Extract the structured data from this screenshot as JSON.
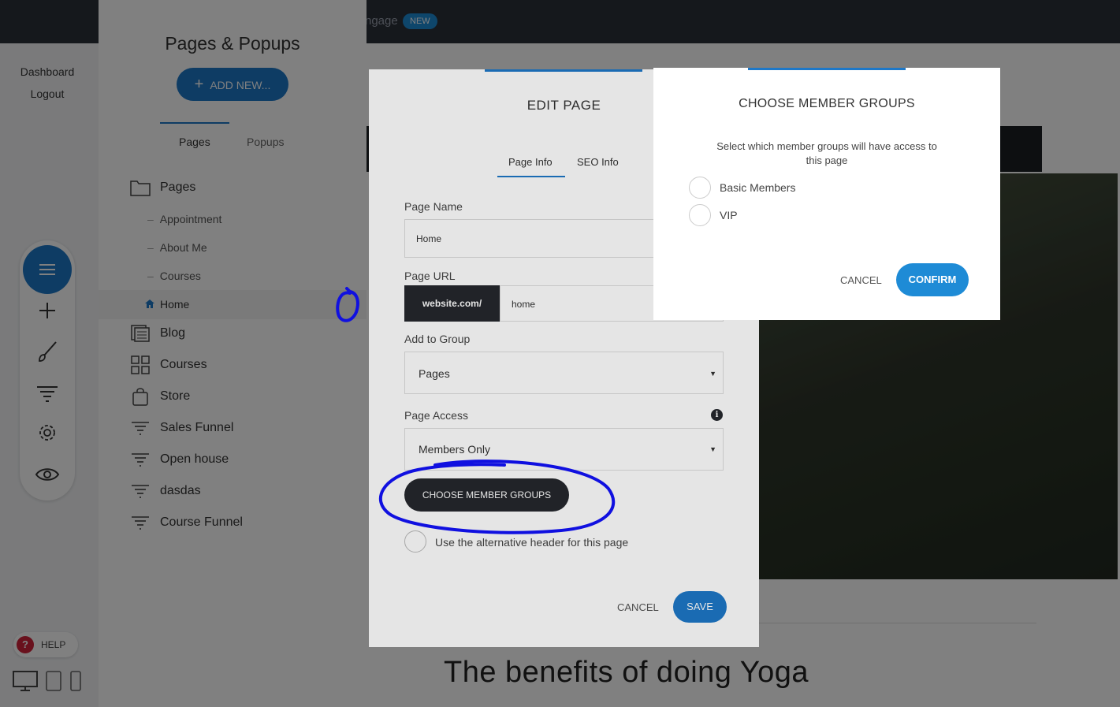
{
  "topbar": {
    "engage_fragment": "ngage",
    "new_badge": "NEW"
  },
  "left_nav": {
    "dashboard": "Dashboard",
    "logout": "Logout",
    "help": "HELP"
  },
  "pages_panel": {
    "title": "Pages & Popups",
    "add_new": "ADD NEW...",
    "tabs": [
      "Pages",
      "Popups"
    ],
    "tree": {
      "pages": "Pages",
      "subpages": [
        "Appointment",
        "About Me",
        "Courses",
        "Home"
      ],
      "items": [
        "Blog",
        "Courses",
        "Store",
        "Sales Funnel",
        "Open house",
        "dasdas",
        "Course Funnel"
      ]
    }
  },
  "edit_page": {
    "title": "EDIT PAGE",
    "tabs": [
      "Page Info",
      "SEO Info"
    ],
    "page_name_label": "Page Name",
    "page_name_value": "Home",
    "page_url_label": "Page URL",
    "url_prefix": "website.com/",
    "url_value": "home",
    "group_label": "Add to Group",
    "group_value": "Pages",
    "access_label": "Page Access",
    "access_value": "Members Only",
    "choose_groups_button": "CHOOSE MEMBER GROUPS",
    "alt_header_label": "Use the alternative header for this page",
    "cancel": "CANCEL",
    "save": "SAVE"
  },
  "member_groups_modal": {
    "title": "CHOOSE MEMBER GROUPS",
    "description": "Select which member groups will have access to this page",
    "options": [
      "Basic Members",
      "VIP"
    ],
    "cancel": "CANCEL",
    "confirm": "CONFIRM"
  },
  "canvas": {
    "heading": "The benefits of doing Yoga"
  },
  "colors": {
    "accent": "#1e78c8",
    "dark": "#25282d",
    "annotation": "#1010e0",
    "topbar": "#2b303a"
  }
}
